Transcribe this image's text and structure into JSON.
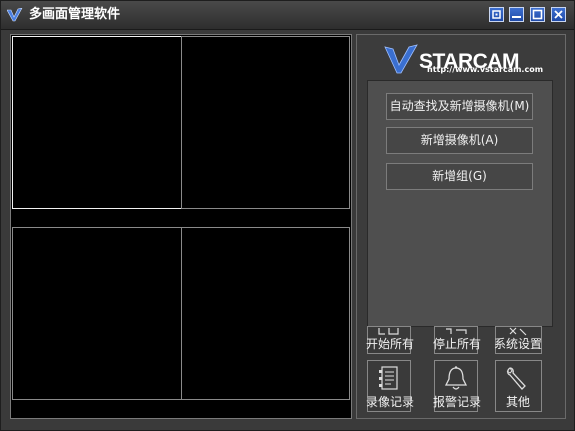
{
  "window": {
    "title": "多画面管理软件"
  },
  "logo": {
    "url_text": "http://www.vstarcam.com"
  },
  "actions": [
    {
      "label": "自动查找及新增摄像机(M)"
    },
    {
      "label": "新增摄像机(A)"
    },
    {
      "label": "新增组(G)"
    }
  ],
  "tools_row1": [
    {
      "label": "开始所有",
      "icon": "play-all-icon"
    },
    {
      "label": "停止所有",
      "icon": "stop-all-icon"
    },
    {
      "label": "系统设置",
      "icon": "settings-icon"
    }
  ],
  "tools_row2": [
    {
      "label": "录像记录",
      "icon": "record-log-icon"
    },
    {
      "label": "报警记录",
      "icon": "alarm-bell-icon"
    },
    {
      "label": "其他",
      "icon": "wrench-icon"
    }
  ],
  "colors": {
    "titlebar_button": "#2a56b8",
    "logo_blue": "#3a6fd0"
  }
}
